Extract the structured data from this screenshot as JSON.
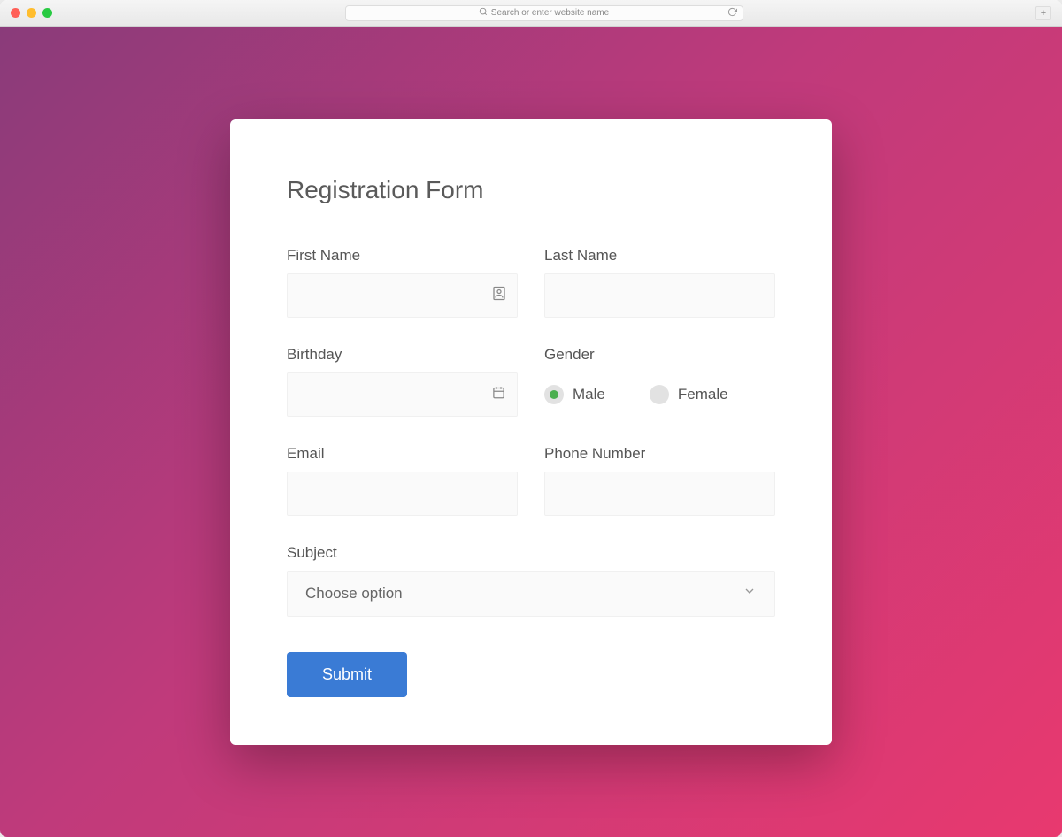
{
  "browser": {
    "address_placeholder": "Search or enter website name"
  },
  "form": {
    "title": "Registration Form",
    "first_name": {
      "label": "First Name",
      "value": ""
    },
    "last_name": {
      "label": "Last Name",
      "value": ""
    },
    "birthday": {
      "label": "Birthday",
      "value": ""
    },
    "gender": {
      "label": "Gender",
      "options": {
        "male": "Male",
        "female": "Female"
      },
      "selected": "male"
    },
    "email": {
      "label": "Email",
      "value": ""
    },
    "phone": {
      "label": "Phone Number",
      "value": ""
    },
    "subject": {
      "label": "Subject",
      "placeholder": "Choose option"
    },
    "submit_label": "Submit"
  }
}
